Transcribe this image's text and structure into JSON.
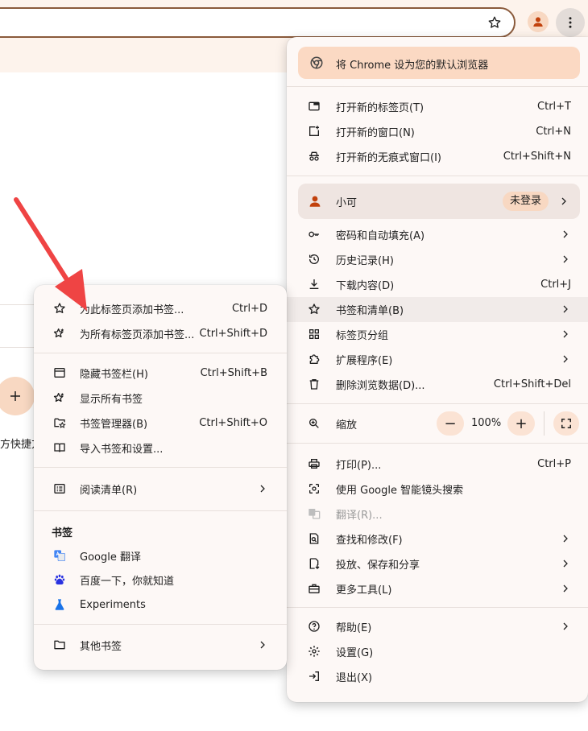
{
  "page": {
    "shortcut_label": "方快捷方"
  },
  "main_menu": {
    "default_browser_banner": "将 Chrome 设为您的默认浏览器",
    "items_group1": [
      {
        "label": "打开新的标签页(T)",
        "shortcut": "Ctrl+T"
      },
      {
        "label": "打开新的窗口(N)",
        "shortcut": "Ctrl+N"
      },
      {
        "label": "打开新的无痕式窗口(I)",
        "shortcut": "Ctrl+Shift+N"
      }
    ],
    "profile": {
      "name": "小可",
      "status": "未登录"
    },
    "items_group2": [
      {
        "label": "密码和自动填充(A)",
        "shortcut": ""
      },
      {
        "label": "历史记录(H)",
        "shortcut": ""
      },
      {
        "label": "下载内容(D)",
        "shortcut": "Ctrl+J"
      },
      {
        "label": "书签和清单(B)",
        "shortcut": ""
      },
      {
        "label": "标签页分组",
        "shortcut": ""
      },
      {
        "label": "扩展程序(E)",
        "shortcut": ""
      },
      {
        "label": "删除浏览数据(D)...",
        "shortcut": "Ctrl+Shift+Del"
      }
    ],
    "zoom": {
      "label": "缩放",
      "minus": "−",
      "value": "100%",
      "plus": "+"
    },
    "items_group3": [
      {
        "label": "打印(P)...",
        "shortcut": "Ctrl+P"
      },
      {
        "label": "使用 Google 智能镜头搜索",
        "shortcut": ""
      },
      {
        "label": "翻译(R)...",
        "shortcut": ""
      },
      {
        "label": "查找和修改(F)",
        "shortcut": ""
      },
      {
        "label": "投放、保存和分享",
        "shortcut": ""
      },
      {
        "label": "更多工具(L)",
        "shortcut": ""
      }
    ],
    "items_group4": [
      {
        "label": "帮助(E)"
      },
      {
        "label": "设置(G)"
      },
      {
        "label": "退出(X)"
      }
    ]
  },
  "bookmarks_submenu": {
    "items_group1": [
      {
        "label": "为此标签页添加书签...",
        "shortcut": "Ctrl+D"
      },
      {
        "label": "为所有标签页添加书签...",
        "shortcut": "Ctrl+Shift+D"
      }
    ],
    "items_group2": [
      {
        "label": "隐藏书签栏(H)",
        "shortcut": "Ctrl+Shift+B"
      },
      {
        "label": "显示所有书签",
        "shortcut": ""
      },
      {
        "label": "书签管理器(B)",
        "shortcut": "Ctrl+Shift+O"
      },
      {
        "label": "导入书签和设置...",
        "shortcut": ""
      }
    ],
    "reading_list": "阅读清单(R)",
    "bookmarks_section_title": "书签",
    "bookmarks": [
      {
        "label": "Google 翻译"
      },
      {
        "label": "百度一下，你就知道"
      },
      {
        "label": "Experiments"
      }
    ],
    "other_bookmarks": "其他书签"
  },
  "colors": {
    "accent": "#c2410c",
    "banner_bg": "#fbd9c3",
    "annotation_arrow": "#ef4444"
  }
}
